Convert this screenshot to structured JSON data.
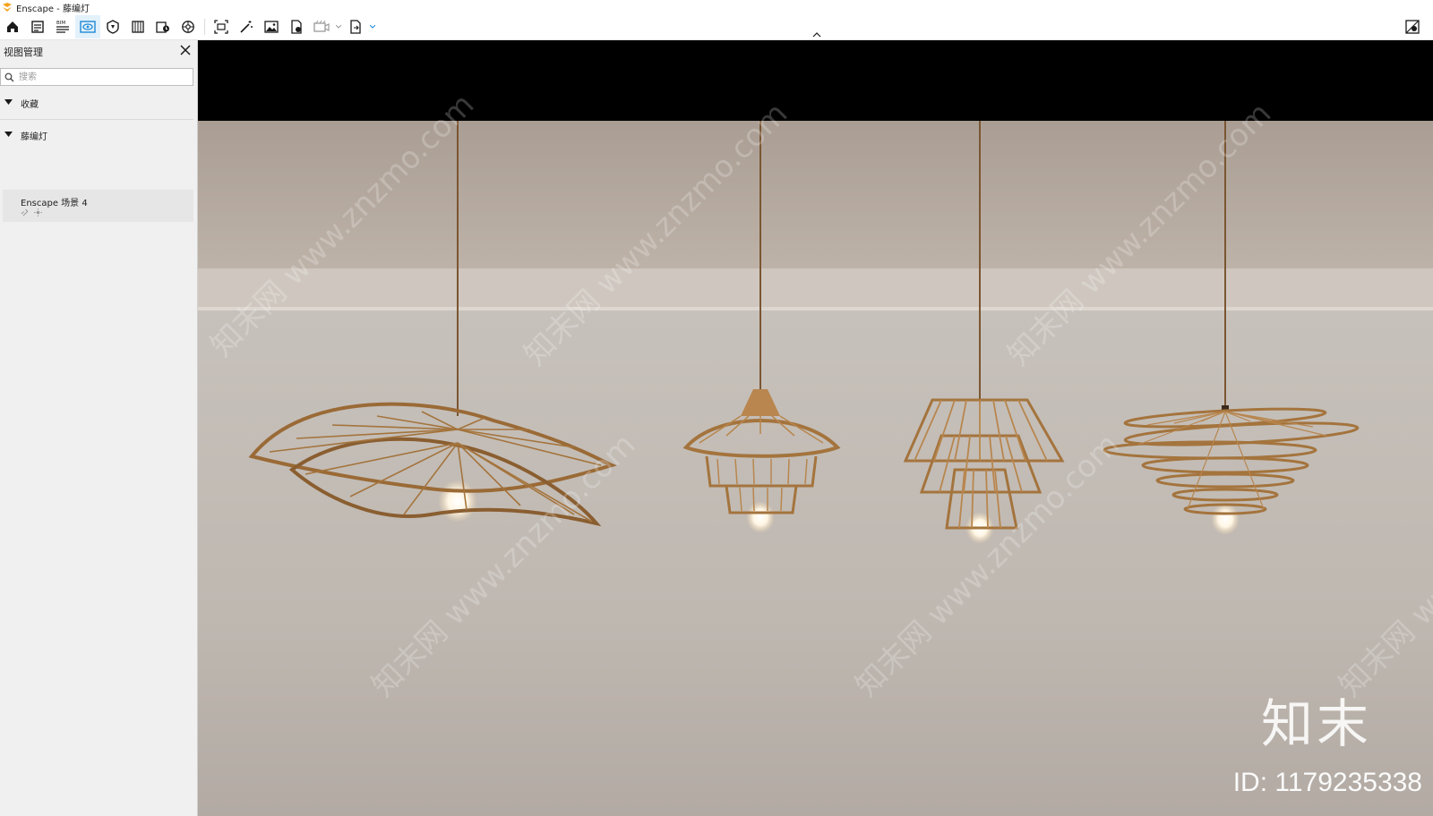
{
  "window": {
    "title": "Enscape - 藤编灯"
  },
  "toolbar": {
    "items": [
      {
        "icon": "home-icon"
      },
      {
        "icon": "document-icon"
      },
      {
        "icon": "bim-icon",
        "label": "BIM"
      },
      {
        "icon": "eye-icon",
        "active": true
      },
      {
        "icon": "asset-library-icon"
      },
      {
        "icon": "material-editor-icon"
      },
      {
        "icon": "batch-render-icon"
      },
      {
        "icon": "settings-icon"
      },
      {
        "icon": "screenshot-icon"
      },
      {
        "icon": "wand-icon"
      },
      {
        "icon": "image-icon"
      },
      {
        "icon": "export-icon"
      },
      {
        "icon": "video-icon"
      },
      {
        "icon": "file-export-icon"
      }
    ]
  },
  "panel": {
    "title": "视图管理",
    "search_placeholder": "搜索",
    "groups": [
      {
        "label": "收藏"
      },
      {
        "label": "藤编灯"
      }
    ],
    "views": [
      {
        "label": "Enscape 场景 4"
      }
    ]
  },
  "watermark": {
    "text": "知末网 www.znzmo.com",
    "brand": "知末",
    "id": "ID: 1179235338"
  },
  "colors": {
    "accent": "#1f8ad6",
    "panel_bg": "#f0f0f0",
    "wall": "#c7c1bb",
    "ceiling": "#b0a49a",
    "rattan": "#a4743d"
  }
}
